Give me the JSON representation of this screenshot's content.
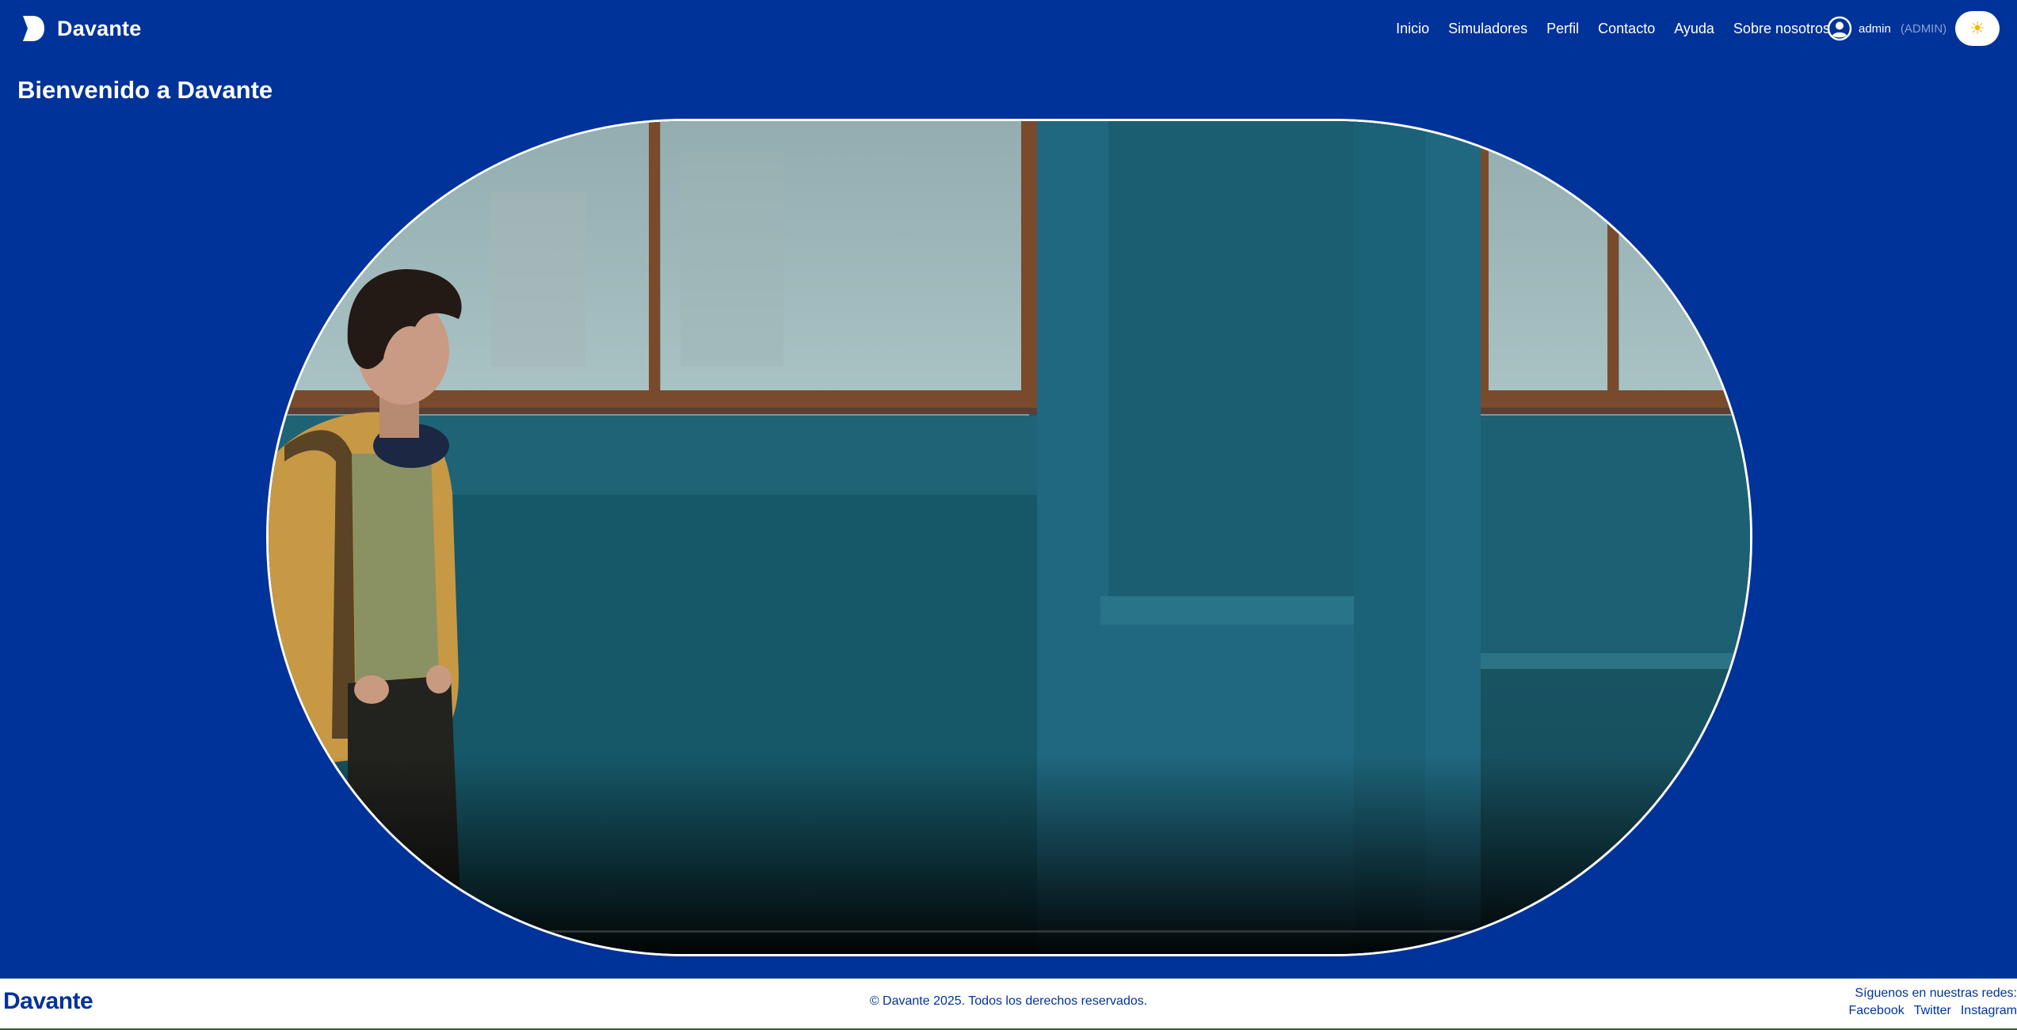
{
  "header": {
    "brand": "Davante",
    "nav": [
      "Inicio",
      "Simuladores",
      "Perfil",
      "Contacto",
      "Ayuda",
      "Sobre nosotros"
    ],
    "user": {
      "name": "admin",
      "role": "(ADMIN)"
    },
    "theme_toggle": "☀"
  },
  "main": {
    "title": "Bienvenido a Davante"
  },
  "footer": {
    "logo": "Davante",
    "copyright": "© Davante 2025. Todos los derechos reservados.",
    "social_title": "Síguenos en nuestras redes:",
    "social_links": [
      "Facebook",
      "Twitter",
      "Instagram"
    ]
  },
  "colors": {
    "background": "#003399",
    "footer_bg": "#ffffff",
    "accent": "#f5b400"
  },
  "icons": {
    "brand": "davante-logo-icon",
    "user": "user-circle-icon",
    "theme": "sun-icon"
  }
}
